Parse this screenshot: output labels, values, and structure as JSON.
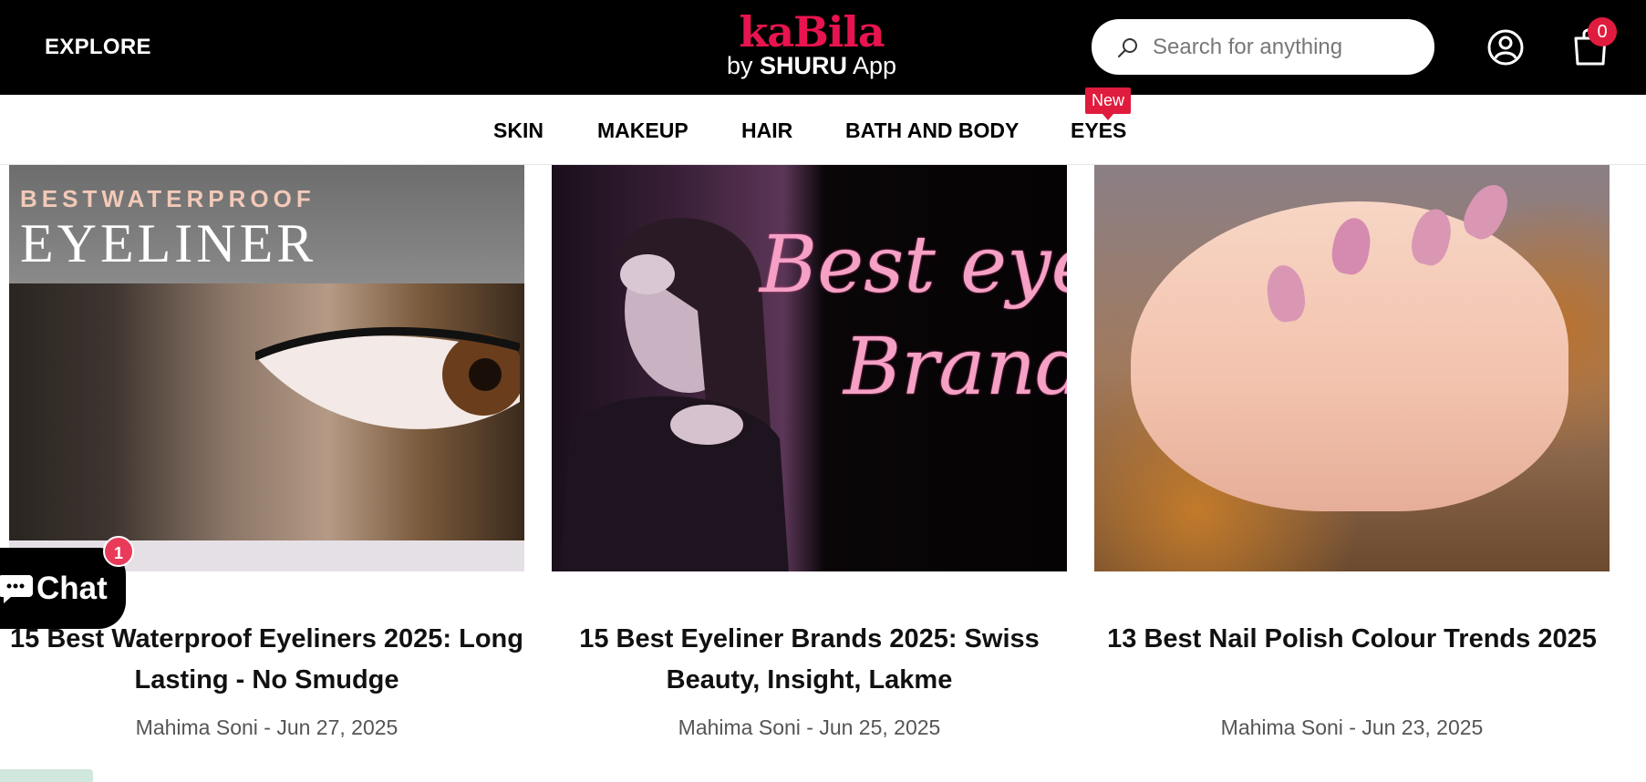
{
  "header": {
    "explore_label": "EXPLORE",
    "logo_main": "kaBila",
    "logo_sub_by": "by",
    "logo_sub_brand": "SHURU",
    "logo_sub_app": "App",
    "search_placeholder": "Search for anything",
    "cart_count": "0",
    "brand_color": "#e8144f"
  },
  "nav": {
    "items": [
      "SKIN",
      "MAKEUP",
      "HAIR",
      "BATH AND BODY",
      "EYES"
    ],
    "new_badge": "New"
  },
  "articles": [
    {
      "image_text_small": "BESTWATERPROOF",
      "image_text_big": "EYELINER",
      "title": "15 Best Waterproof Eyeliners 2025: Long Lasting - No Smudge",
      "meta": "Mahima Soni - Jun 27, 2025"
    },
    {
      "image_text_line1": "Best eyeli",
      "image_text_line2": "Brands",
      "title": "15 Best Eyeliner Brands 2025: Swiss Beauty, Insight, Lakme",
      "meta": "Mahima Soni - Jun 25, 2025"
    },
    {
      "title": "13 Best Nail Polish Colour Trends 2025",
      "meta": "Mahima Soni - Jun 23, 2025"
    }
  ],
  "chat": {
    "label": "Chat",
    "badge": "1"
  }
}
